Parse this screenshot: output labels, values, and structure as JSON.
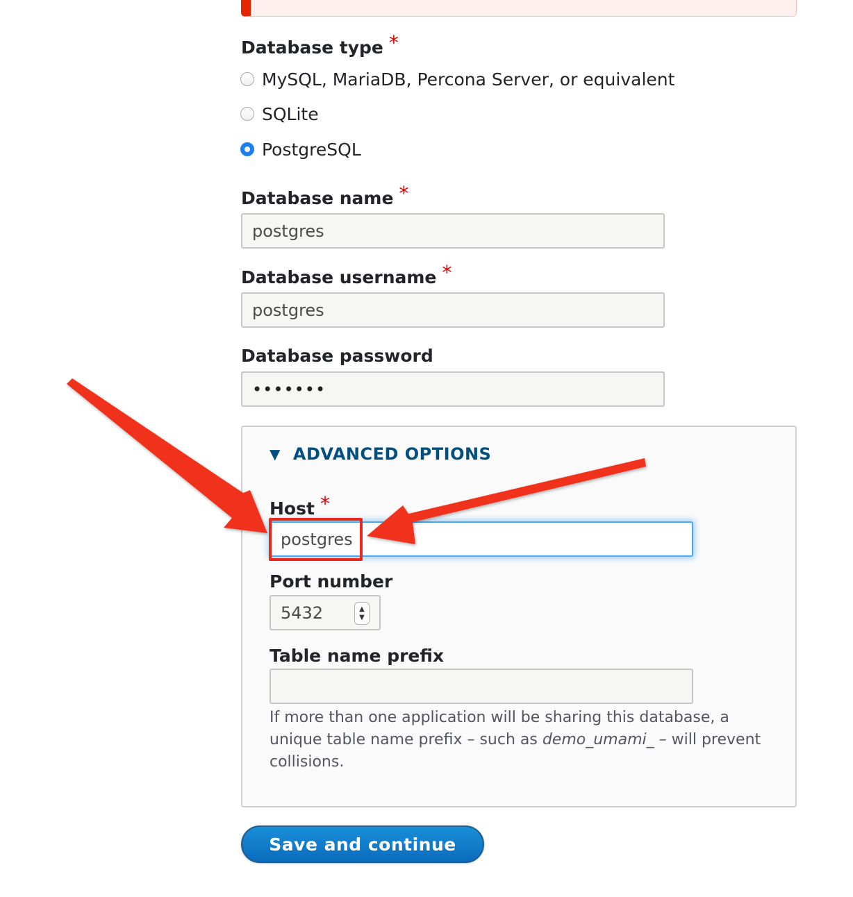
{
  "form": {
    "db_type": {
      "label": "Database type",
      "required_mark": "*",
      "options": [
        {
          "label": "MySQL, MariaDB, Percona Server, or equivalent",
          "selected": false
        },
        {
          "label": "SQLite",
          "selected": false
        },
        {
          "label": "PostgreSQL",
          "selected": true
        }
      ]
    },
    "db_name": {
      "label": "Database name",
      "required_mark": "*",
      "value": "postgres"
    },
    "db_username": {
      "label": "Database username",
      "required_mark": "*",
      "value": "postgres"
    },
    "db_password": {
      "label": "Database password",
      "value": "•••••••"
    },
    "advanced": {
      "toggle_icon": "triangle-down-icon",
      "title": "ADVANCED OPTIONS",
      "host": {
        "label": "Host",
        "required_mark": "*",
        "value": "postgres"
      },
      "port": {
        "label": "Port number",
        "value": "5432"
      },
      "prefix": {
        "label": "Table name prefix",
        "value": "",
        "help_before": "If more than one application will be sharing this database, a unique table name prefix – such as ",
        "help_example": "demo_umami_",
        "help_after": " – will prevent collisions."
      }
    },
    "submit_label": "Save and continue"
  },
  "colors": {
    "required": "#e00000",
    "accent": "#004f80",
    "radio_checked": "#1b7ef3",
    "focus": "#4aa6f2",
    "annotation": "#e8291c",
    "button": "#0a6bbd"
  }
}
